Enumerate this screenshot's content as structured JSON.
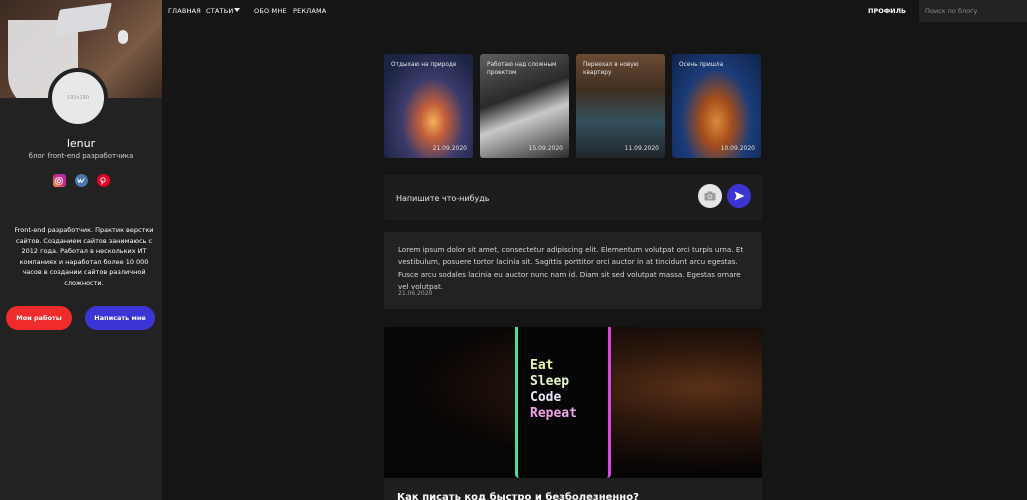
{
  "nav": {
    "items": [
      "ГЛАВНАЯ",
      "СТАТЬИ",
      "ОБО МНЕ",
      "РЕКЛАМА"
    ],
    "profile": "ПРОФИЛЬ",
    "search_placeholder": "Поиск по блогу"
  },
  "sidebar": {
    "avatar_placeholder": "192x190",
    "name": "lenur",
    "description": "блог front-end разработчика",
    "socials": [
      "instagram-icon",
      "vk-icon",
      "pinterest-icon"
    ],
    "about": "Front-end разработчик. Практик верстки сайтов. Созданием сайтов занимаюсь с 2012 года. Работал в нескольких ИТ компаниях и наработал более 10 000 часов в создании сайтов различной сложности.",
    "btn_works": "Мои работы",
    "btn_write": "Написать мне"
  },
  "stories": [
    {
      "title": "Отдыхаю на природе",
      "date": "21.09.2020"
    },
    {
      "title": "Работаю над сложным проектом",
      "date": "15.09.2020"
    },
    {
      "title": "Переехал в новую квартиру",
      "date": "11.09.2020"
    },
    {
      "title": "Осень пришла",
      "date": "10.09.2020"
    }
  ],
  "composer": {
    "placeholder": "Напишите что-нибудь"
  },
  "post": {
    "text": "Lorem ipsum dolor sit amet, consectetur adipiscing elit. Elementum volutpat orci turpis urna. Et vestibulum, posuere tortor lacinia sit. Sagittis porttitor orci auctor in at tincidunt arcu egestas. Fusce arcu sodales lacinia eu auctor nunc nam id. Diam sit sed volutpat massa. Egestas ornare vel volutpat.",
    "date": "21.06.2020"
  },
  "article": {
    "image_lines": [
      "Eat",
      "Sleep",
      "Code",
      "Repeat"
    ],
    "title": "Как писать код быстро и безболезненно?"
  },
  "colors": {
    "accent_red": "#ef2b2b",
    "accent_blue": "#3b35d4",
    "background": "#151515",
    "panel": "#222222"
  }
}
